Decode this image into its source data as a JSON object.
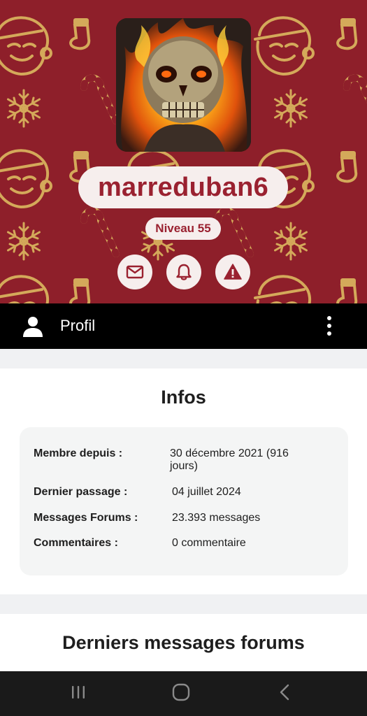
{
  "profile": {
    "username": "marreduban6",
    "level": "Niveau 55"
  },
  "actions": [
    {
      "icon": "mail-icon"
    },
    {
      "icon": "bell-icon"
    },
    {
      "icon": "warning-icon"
    }
  ],
  "topbar": {
    "title": "Profil",
    "icon": "user-icon",
    "menu_icon": "more-vertical-icon"
  },
  "infos": {
    "title": "Infos",
    "rows": [
      {
        "label": "Membre depuis :",
        "value_line1": "30 décembre 2021 (916",
        "value_line2": "jours)"
      },
      {
        "label": "Dernier passage :",
        "value": "04 juillet 2024"
      },
      {
        "label": "Messages Forums :",
        "value": "23.393 messages"
      },
      {
        "label": "Commentaires :",
        "value": "0 commentaire"
      }
    ]
  },
  "forum": {
    "title": "Derniers messages forums"
  },
  "colors": {
    "banner": "#8e1f2a",
    "pattern": "#d4a95a",
    "accent": "#9a2130",
    "pill": "#f6eeed"
  }
}
